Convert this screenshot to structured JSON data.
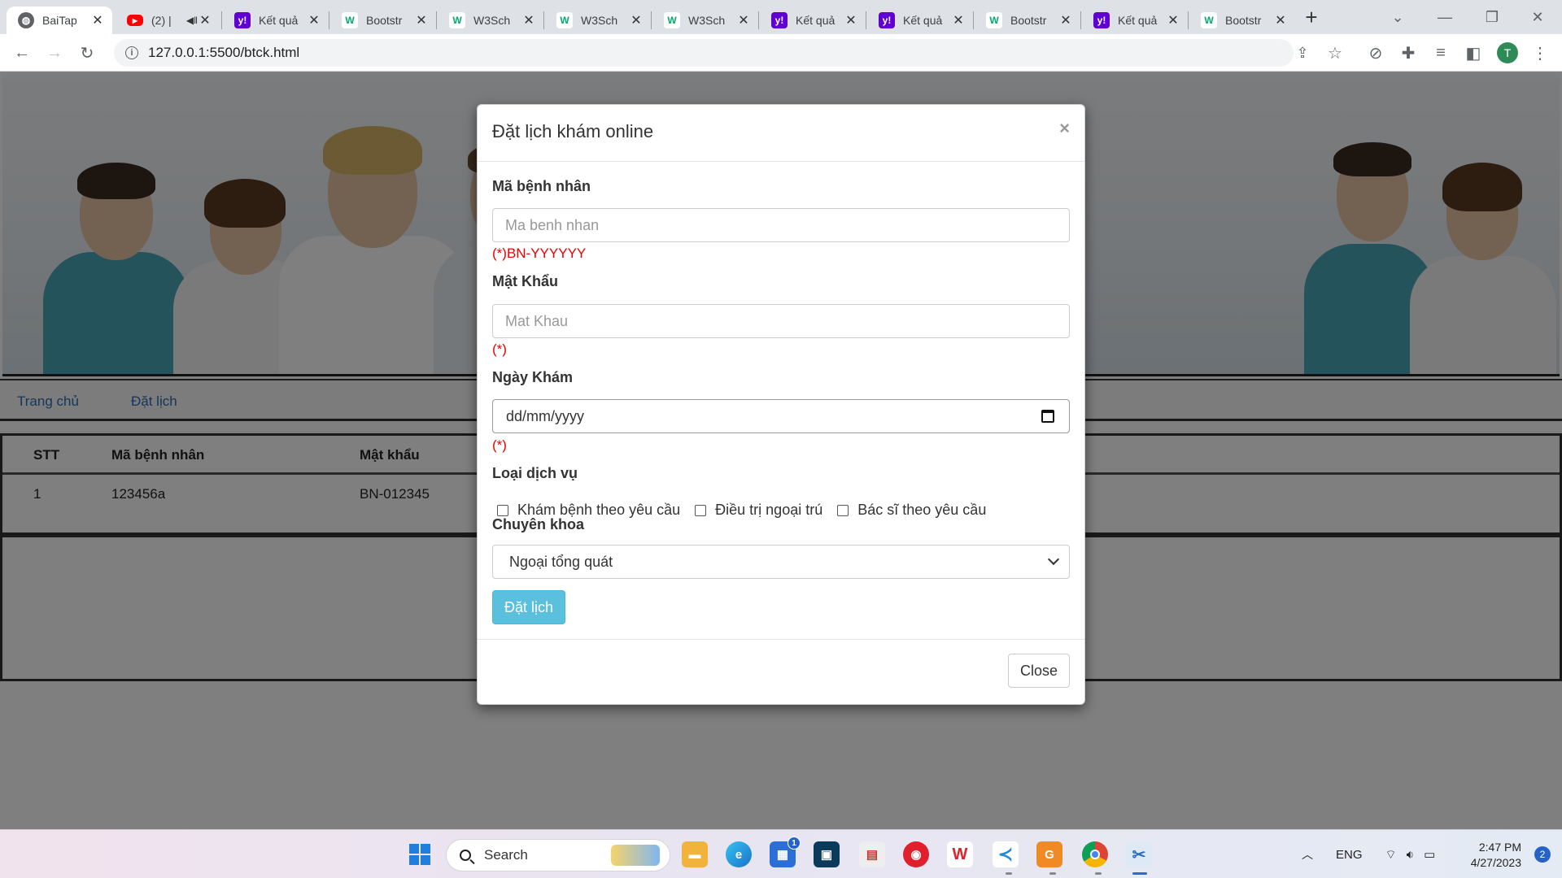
{
  "browser": {
    "tabs": [
      {
        "title": "BaiTap",
        "favicon": "globe-icon",
        "active": true
      },
      {
        "title": "(2) |",
        "favicon": "youtube-icon"
      },
      {
        "title": "Kết quả",
        "favicon": "yahoo-icon"
      },
      {
        "title": "Bootstr",
        "favicon": "w3schools-icon"
      },
      {
        "title": "W3Sch",
        "favicon": "w3schools-icon"
      },
      {
        "title": "W3Sch",
        "favicon": "w3schools-icon"
      },
      {
        "title": "W3Sch",
        "favicon": "w3schools-icon"
      },
      {
        "title": "Kết quả",
        "favicon": "yahoo-icon"
      },
      {
        "title": "Kết quả",
        "favicon": "yahoo-icon"
      },
      {
        "title": "Bootstr",
        "favicon": "w3schools-icon"
      },
      {
        "title": "Kết quả",
        "favicon": "yahoo-icon"
      },
      {
        "title": "Bootstr",
        "favicon": "w3schools-icon"
      }
    ],
    "url": "127.0.0.1:5500/btck.html",
    "profile_initial": "T",
    "colors": {
      "yahoo": "#6001d2",
      "w3schools": "#04aa6d",
      "youtube": "#ff0000",
      "profile": "#2e8b57"
    }
  },
  "page": {
    "nav": {
      "home": "Trang chủ",
      "booking": "Đặt lịch"
    },
    "table": {
      "headers": [
        "STT",
        "Mã bệnh nhân",
        "Mật khẩu"
      ],
      "rows": [
        [
          "1",
          "123456a",
          "BN-012345"
        ]
      ]
    }
  },
  "modal": {
    "title": "Đặt lịch khám online",
    "close_x": "×",
    "patient_id": {
      "label": "Mã bệnh nhân",
      "placeholder": "Ma benh nhan",
      "hint": "(*)BN-YYYYYY"
    },
    "password": {
      "label": "Mật Khẩu",
      "placeholder": "Mat Khau",
      "hint": "(*)"
    },
    "date": {
      "label": "Ngày Khám",
      "value": "dd/mm/yyyy",
      "hint": "(*)"
    },
    "service": {
      "label": "Loại dịch vụ",
      "options": [
        "Khám bệnh theo yêu cầu",
        "Điều trị ngoại trú",
        "Bác sĩ theo yêu cầu"
      ]
    },
    "specialty": {
      "label": "Chuyên khoa",
      "selected": "Ngoại tổng quát"
    },
    "submit_label": "Đặt lịch",
    "close_label": "Close",
    "colors": {
      "submit_bg": "#5bc0de",
      "hint": "#ee0000"
    }
  },
  "taskbar": {
    "search_label": "Search",
    "language": "ENG",
    "time": "2:47 PM",
    "date": "4/27/2023",
    "notification_count": "2",
    "store_badge": "1"
  }
}
